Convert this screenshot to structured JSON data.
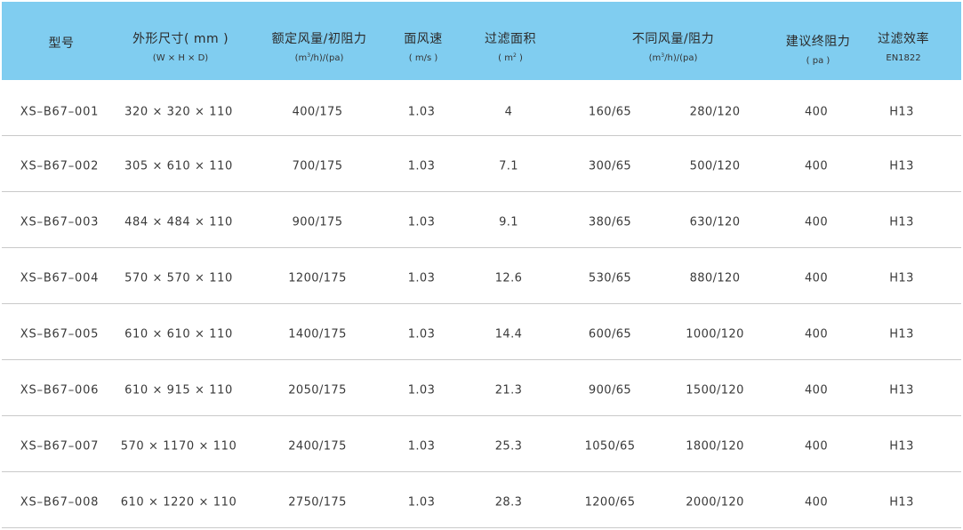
{
  "header": {
    "columns": [
      {
        "key": "model",
        "label": "型号",
        "sub": ""
      },
      {
        "key": "dims",
        "label": "外形尺寸( mm )",
        "sub": "(W × H × D)"
      },
      {
        "key": "rated",
        "label": "额定风量/初阻力",
        "sub": "(m³/h)/(pa)"
      },
      {
        "key": "velocity",
        "label": "面风速",
        "sub": "( m/s )"
      },
      {
        "key": "area",
        "label": "过滤面积",
        "sub": "( m² )"
      },
      {
        "key": "airflow",
        "label": "不同风量/阻力",
        "sub": "(m³/h)/(pa)"
      },
      {
        "key": "final",
        "label": "建议终阻力",
        "sub": "( pa )"
      },
      {
        "key": "efficiency",
        "label": "过滤效率",
        "sub": "EN1822"
      }
    ]
  },
  "rows": [
    {
      "model": "XS–B67–001",
      "dims": "320 × 320 × 110",
      "rated": "400/175",
      "velocity": "1.03",
      "area": "4",
      "airflow_a": "160/65",
      "airflow_b": "280/120",
      "final": "400",
      "efficiency": "H13"
    },
    {
      "model": "XS–B67–002",
      "dims": "305 × 610 × 110",
      "rated": "700/175",
      "velocity": "1.03",
      "area": "7.1",
      "airflow_a": "300/65",
      "airflow_b": "500/120",
      "final": "400",
      "efficiency": "H13"
    },
    {
      "model": "XS–B67–003",
      "dims": "484 × 484 × 110",
      "rated": "900/175",
      "velocity": "1.03",
      "area": "9.1",
      "airflow_a": "380/65",
      "airflow_b": "630/120",
      "final": "400",
      "efficiency": "H13"
    },
    {
      "model": "XS–B67–004",
      "dims": "570 × 570 × 110",
      "rated": "1200/175",
      "velocity": "1.03",
      "area": "12.6",
      "airflow_a": "530/65",
      "airflow_b": "880/120",
      "final": "400",
      "efficiency": "H13"
    },
    {
      "model": "XS–B67–005",
      "dims": "610 × 610 × 110",
      "rated": "1400/175",
      "velocity": "1.03",
      "area": "14.4",
      "airflow_a": "600/65",
      "airflow_b": "1000/120",
      "final": "400",
      "efficiency": "H13"
    },
    {
      "model": "XS–B67–006",
      "dims": "610 × 915 × 110",
      "rated": "2050/175",
      "velocity": "1.03",
      "area": "21.3",
      "airflow_a": "900/65",
      "airflow_b": "1500/120",
      "final": "400",
      "efficiency": "H13"
    },
    {
      "model": "XS–B67–007",
      "dims": "570 × 1170 × 110",
      "rated": "2400/175",
      "velocity": "1.03",
      "area": "25.3",
      "airflow_a": "1050/65",
      "airflow_b": "1800/120",
      "final": "400",
      "efficiency": "H13"
    },
    {
      "model": "XS–B67–008",
      "dims": "610 × 1220 × 110",
      "rated": "2750/175",
      "velocity": "1.03",
      "area": "28.3",
      "airflow_a": "1200/65",
      "airflow_b": "2000/120",
      "final": "400",
      "efficiency": "H13"
    }
  ],
  "colors": {
    "header_bg": "#80cdf0",
    "divider": "#c9c9c9",
    "text": "#3a3a3a"
  }
}
